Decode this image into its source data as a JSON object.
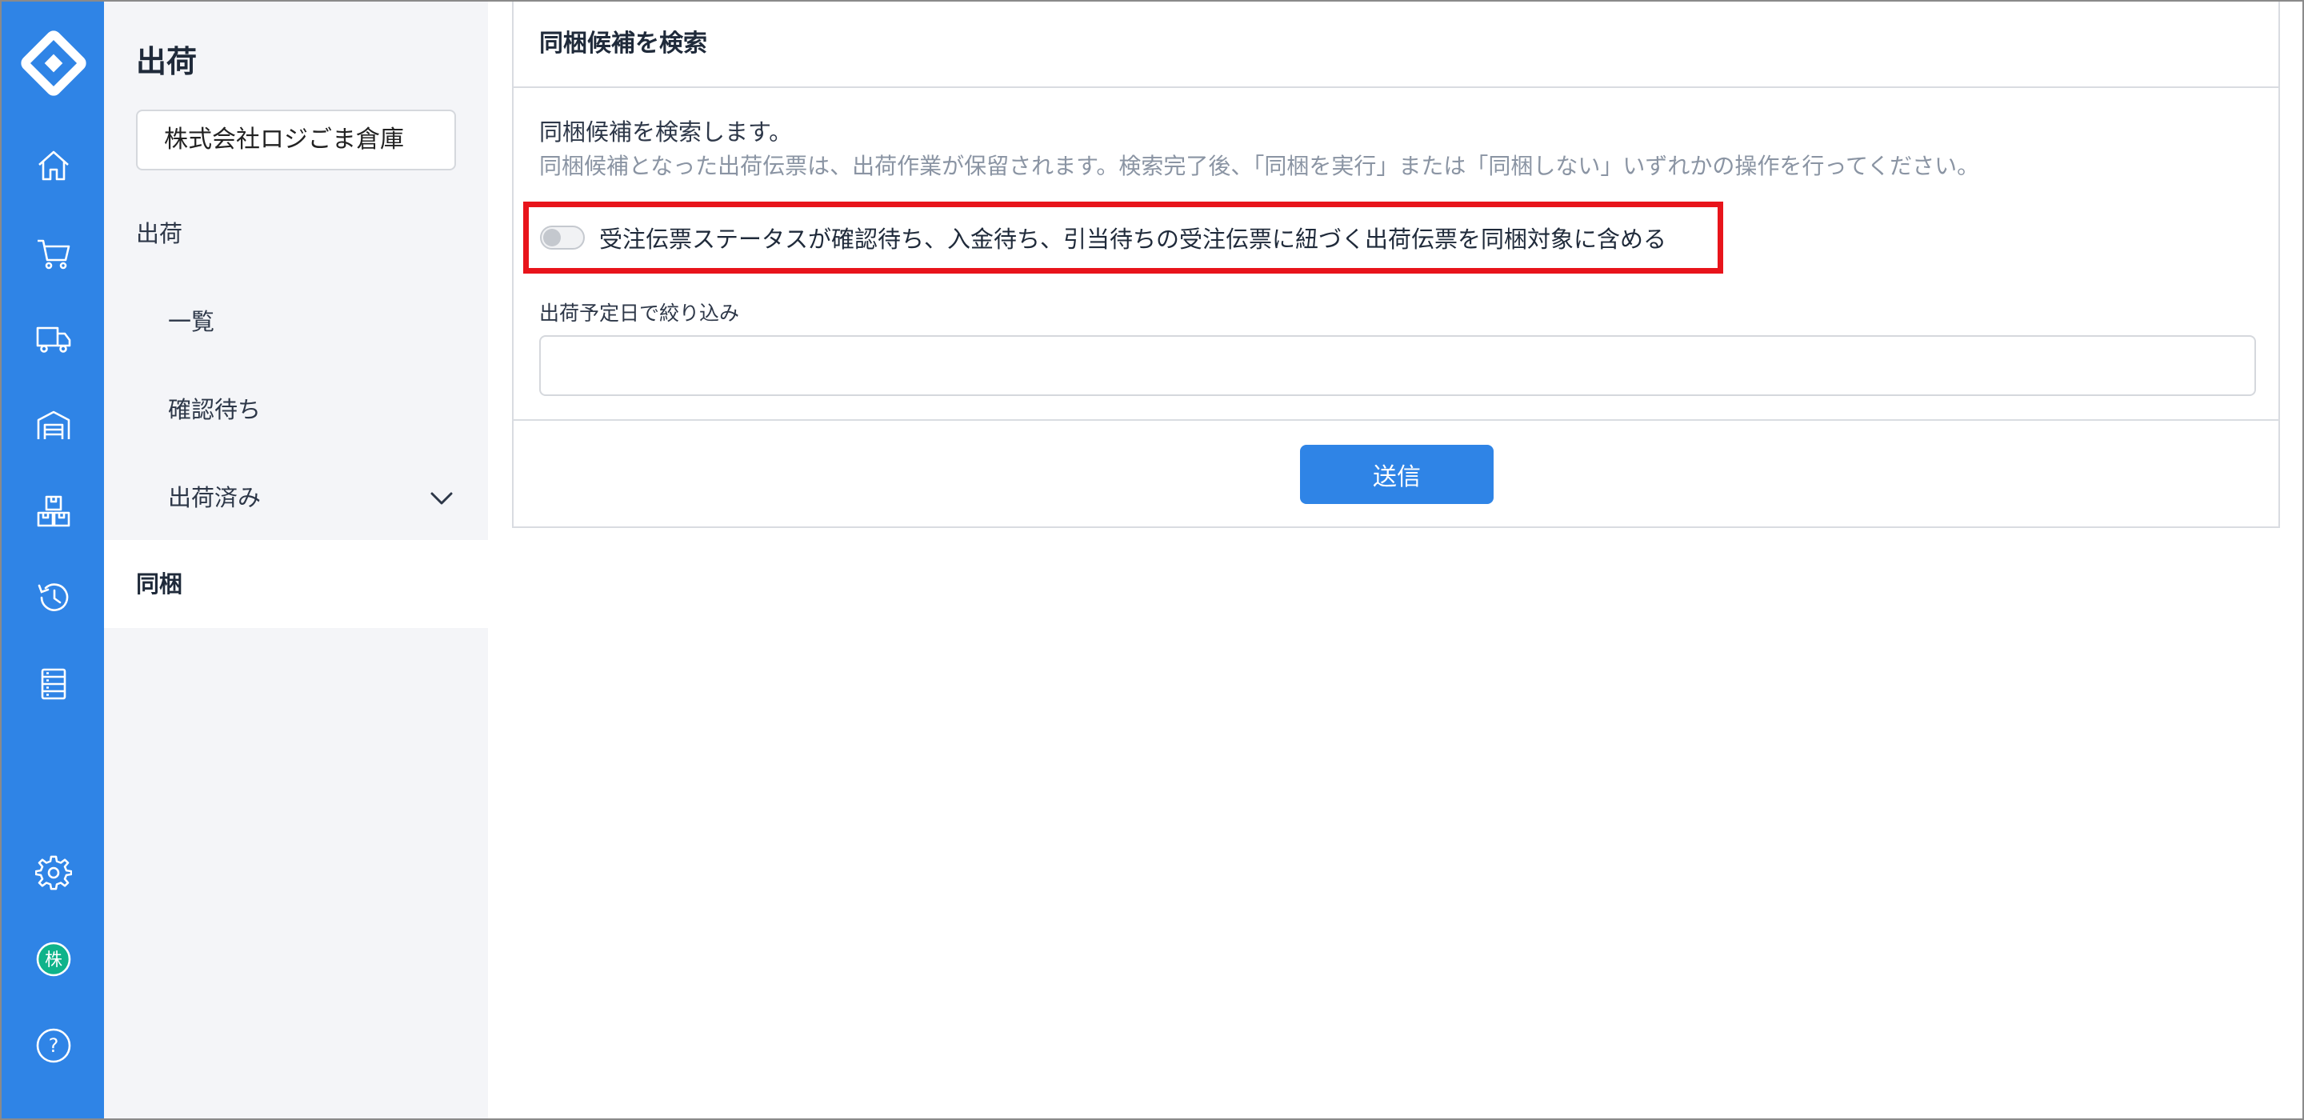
{
  "theme": {
    "accent": "#2f84e6",
    "highlight": "#e8141b",
    "avatar_color": "#0fb38a"
  },
  "rail": {
    "icons": [
      "logo-icon",
      "home-icon",
      "cart-icon",
      "truck-icon",
      "warehouse-icon",
      "boxes-icon",
      "history-icon",
      "document-list-icon",
      "gear-icon",
      "avatar",
      "help-icon"
    ],
    "avatar_text": "株",
    "help_text": "?"
  },
  "subnav": {
    "title": "出荷",
    "company": "株式会社ロジごま倉庫",
    "items": [
      {
        "label": "出荷"
      },
      {
        "label": "一覧"
      },
      {
        "label": "確認待ち"
      },
      {
        "label": "出荷済み"
      },
      {
        "label": "同梱"
      }
    ]
  },
  "panel": {
    "title": "同梱候補を検索",
    "description": "同梱候補を検索します。",
    "note": "同梱候補となった出荷伝票は、出荷作業が保留されます。検索完了後、「同梱を実行」または「同梱しない」いずれかの操作を行ってください。",
    "toggle_label": "受注伝票ステータスが確認待ち、入金待ち、引当待ちの受注伝票に紐づく出荷伝票を同梱対象に含める",
    "toggle_on": false,
    "date_label": "出荷予定日で絞り込み",
    "date_value": "",
    "submit_label": "送信"
  }
}
